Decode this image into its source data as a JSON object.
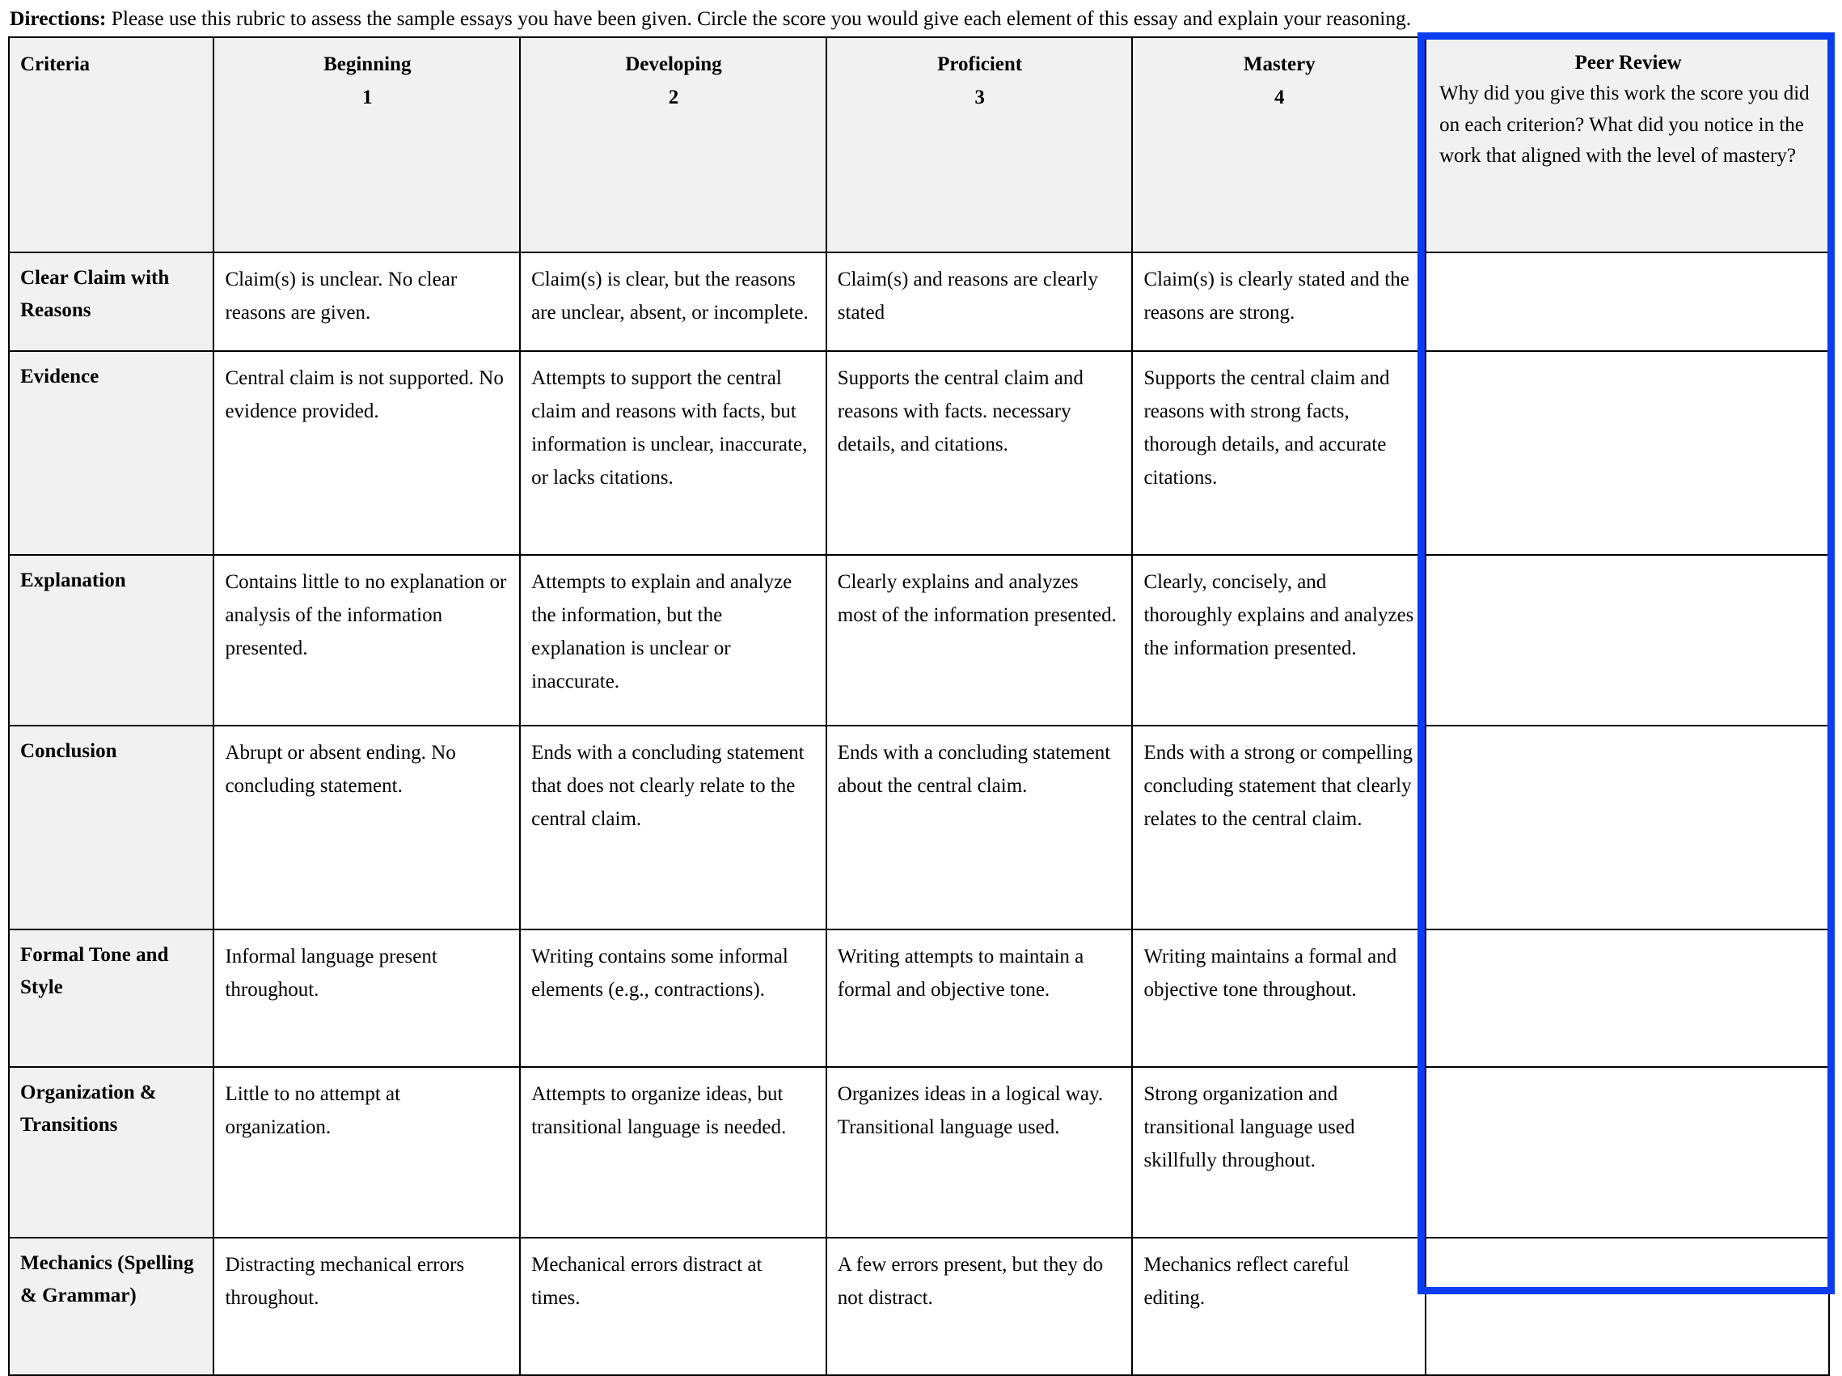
{
  "document": {
    "directions_label": "Directions:",
    "directions_text": " Please use this rubric to assess the sample essays you have been given. Circle the score you would give each element of this essay and explain your reasoning."
  },
  "highlight": {
    "color": "#0b3df0",
    "target_column": "Peer Review"
  },
  "table": {
    "header": {
      "criteria": "Criteria",
      "levels": [
        {
          "label": "Beginning",
          "score": "1"
        },
        {
          "label": "Developing",
          "score": "2"
        },
        {
          "label": "Proficient",
          "score": "3"
        },
        {
          "label": "Mastery",
          "score": "4"
        }
      ],
      "peer_review": {
        "title": "Peer Review",
        "prompt": "Why did you give this work the score you did on each criterion? What did you notice in the work that aligned with the level of mastery?"
      }
    },
    "rows": [
      {
        "criteria": "Clear Claim with Reasons",
        "beginning": "Claim(s) is unclear. No clear reasons are given.",
        "developing": "Claim(s) is clear, but the reasons are unclear, absent, or incomplete.",
        "proficient": "Claim(s) and reasons are clearly stated",
        "mastery": "Claim(s) is clearly stated and the reasons are strong.",
        "peer_review": ""
      },
      {
        "criteria": "Evidence",
        "beginning": "Central claim is not supported. No evidence provided.",
        "developing": "Attempts to support the central claim and reasons with facts, but information is unclear, inaccurate, or lacks citations.",
        "proficient": "Supports the central claim and reasons with facts. necessary details, and citations.",
        "mastery": "Supports the central claim and reasons with strong facts, thorough details, and accurate citations.",
        "peer_review": ""
      },
      {
        "criteria": "Explanation",
        "beginning": "Contains little to no explanation or analysis of the information presented.",
        "developing": "Attempts to explain and analyze the information, but the explanation is unclear or inaccurate.",
        "proficient": "Clearly explains and analyzes most of the information presented.",
        "mastery": "Clearly, concisely, and thoroughly explains and analyzes the information presented.",
        "peer_review": ""
      },
      {
        "criteria": "Conclusion",
        "beginning": "Abrupt or absent ending. No concluding statement.",
        "developing": "Ends with a concluding statement that does not clearly relate to the central claim.",
        "proficient": "Ends with a concluding statement about the central claim.",
        "mastery": "Ends with a strong or compelling concluding statement that clearly relates to the central claim.",
        "peer_review": ""
      },
      {
        "criteria": "Formal Tone and Style",
        "beginning": "Informal language present throughout.",
        "developing": "Writing contains some informal elements (e.g., contractions).",
        "proficient": "Writing attempts to maintain a formal and objective tone.",
        "mastery": "Writing maintains a formal and objective tone throughout.",
        "peer_review": ""
      },
      {
        "criteria": "Organization & Transitions",
        "beginning": "Little to no attempt at organization.",
        "developing": "Attempts to organize ideas, but transitional language is needed.",
        "proficient": "Organizes ideas in a logical way. Transitional language used.",
        "mastery": "Strong organization and transitional language used skillfully throughout.",
        "peer_review": ""
      },
      {
        "criteria": "Mechanics (Spelling & Grammar)",
        "beginning": "Distracting mechanical errors throughout.",
        "developing": "Mechanical errors distract at times.",
        "proficient": "A few errors present, but they do not distract.",
        "mastery": "Mechanics reflect careful editing.",
        "peer_review": ""
      }
    ]
  }
}
